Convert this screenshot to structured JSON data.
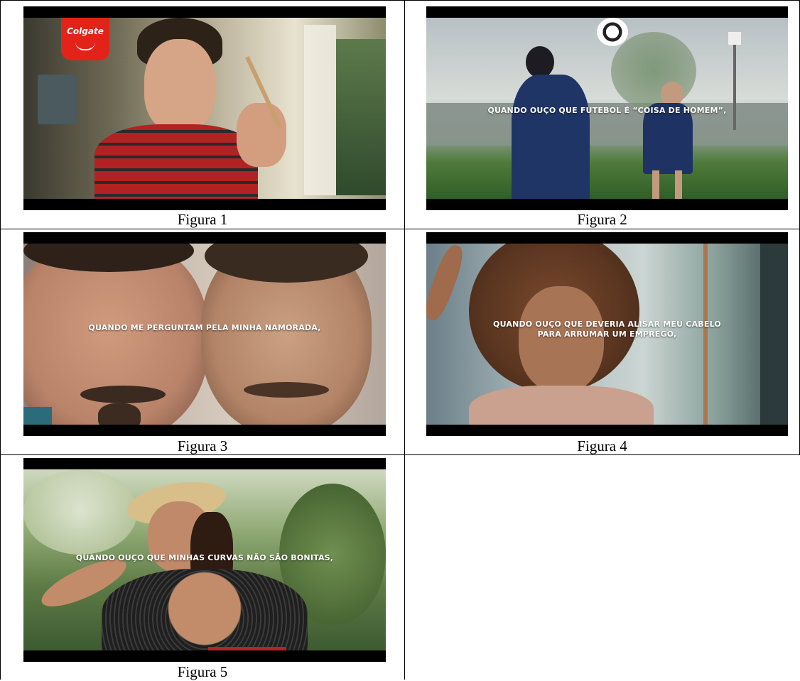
{
  "figures": [
    {
      "caption": "Figura 1",
      "subtitle": "",
      "brand_logo": "Colgate"
    },
    {
      "caption": "Figura 2",
      "subtitle": "QUANDO OUÇO QUE FUTEBOL É “COISA DE HOMEM”,"
    },
    {
      "caption": "Figura 3",
      "subtitle": "QUANDO ME PERGUNTAM PELA MINHA NAMORADA,"
    },
    {
      "caption": "Figura 4",
      "subtitle_line1": "QUANDO OUÇO QUE DEVERIA ALISAR MEU CABELO",
      "subtitle_line2": "PARA ARRUMAR UM EMPREGO,"
    },
    {
      "caption": "Figura 5",
      "subtitle": "QUANDO OUÇO QUE MINHAS CURVAS NÃO SÃO BONITAS,"
    }
  ]
}
